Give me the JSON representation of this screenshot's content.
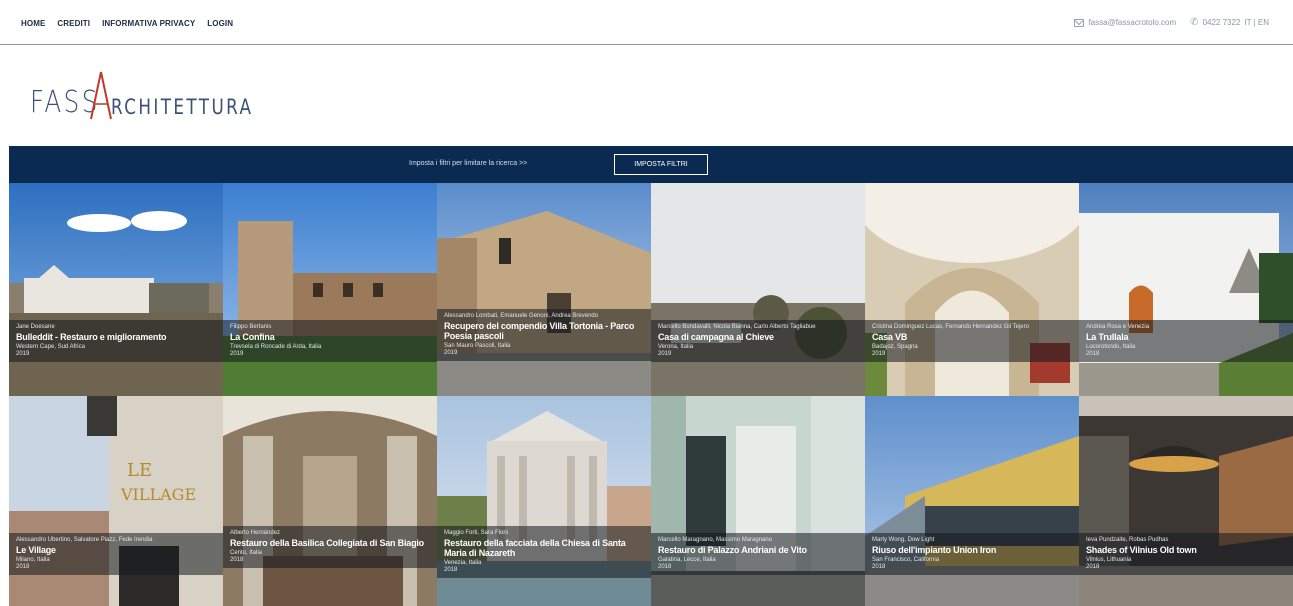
{
  "nav": {
    "items": [
      {
        "label": "HOME"
      },
      {
        "label": "CREDITI"
      },
      {
        "label": "INFORMATIVA PRIVACY"
      },
      {
        "label": "LOGIN"
      }
    ]
  },
  "contact": {
    "email": "fassa@fassacrotolo.com",
    "phone": "0422 7322",
    "lang": "IT | EN",
    "mail_icon": "mail-icon",
    "phone_icon": "phone-icon"
  },
  "logo": {
    "part1": "FASS",
    "part2": "RCHITETTURA",
    "accent_color": "#c0392b",
    "text_color": "#3a5278"
  },
  "filter": {
    "prompt": "Imposta i filtri per limitare la ricerca  >>",
    "button": "IMPOSTA FILTRI",
    "bar_color": "#0b2a52"
  },
  "projects": [
    {
      "authors": "Jane Doesane",
      "title": "Bulleddit - Restauro e miglioramento",
      "place": "Western Cape, Sud Africa",
      "year": "2019"
    },
    {
      "authors": "Filippo Bertanis",
      "title": "La Confina",
      "place": "Trevsela di Roncade di Arda, Italia",
      "year": "2019"
    },
    {
      "authors": "Alessandro Lombati, Emanuele Genoni, Andrea Brevendo",
      "title": "Recupero del compendio Villa Tortonia - Parco Poesia pascoli",
      "place": "San Mauro Pascoli, Italia",
      "year": "2019"
    },
    {
      "authors": "Marcello Bondavalli, Nicola Bianna, Carlo Alberto Tagliabue",
      "title": "Casa di campagna al Chieve",
      "place": "Verona, Italia",
      "year": "2019"
    },
    {
      "authors": "Cristina Dominguez Lucas, Fernando Hernandez Gil Tejero",
      "title": "Casa VB",
      "place": "Badajoz, Spagna",
      "year": "2019"
    },
    {
      "authors": "Andrea Rosa e Venezia",
      "title": "La Trullala",
      "place": "Locorotondo, Italia",
      "year": "2018"
    },
    {
      "authors": "Alessandro Ubertino, Salvatore Piazz, Fede Irendia",
      "title": "Le Village",
      "place": "Milano, Italia",
      "year": "2018"
    },
    {
      "authors": "Alberto Hernández",
      "title": "Restauro della Basilica Collegiata di San Biagio",
      "place": "Cento, Italia",
      "year": "2018"
    },
    {
      "authors": "Maggio Forti, Sara Floni",
      "title": "Restauro della facciata della Chiesa di Santa Maria di Nazareth",
      "place": "Venezia, Italia",
      "year": "2018"
    },
    {
      "authors": "Marcello Maragnano, Massimo Maragnano",
      "title": "Restauro di Palazzo Andriani de Vito",
      "place": "Galatina, Lecce, Italia",
      "year": "2018"
    },
    {
      "authors": "Marty Wong, Dow Light",
      "title": "Riuso dell'impianto Union Iron",
      "place": "San Francisco, California",
      "year": "2018"
    },
    {
      "authors": "Ieva Pundzaite, Robas Pudhas",
      "title": "Shades of Vilnius Old town",
      "place": "Vilnius, Lithuania",
      "year": "2018"
    }
  ]
}
